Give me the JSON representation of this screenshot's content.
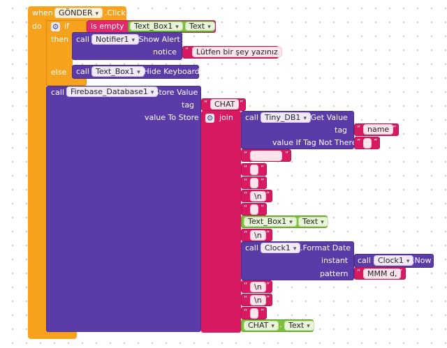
{
  "event": {
    "when": "when",
    "component": "GÖNDER",
    "event_name": ".Click",
    "do": "do"
  },
  "if_block": {
    "if": "if",
    "is_empty": "is empty",
    "then": "then",
    "else": "else"
  },
  "textbox_text": {
    "component": "Text_Box1",
    "prop": "Text",
    "dot": "."
  },
  "show_alert": {
    "call": "call",
    "component": "Notifier1",
    "method": ".Show Alert",
    "notice_label": "notice",
    "notice_value": "Lütfen bir şey yazınız"
  },
  "hide_keyboard": {
    "call": "call",
    "component": "Text_Box1",
    "method": ".Hide Keyboard"
  },
  "store_value": {
    "call": "call",
    "component": "Firebase_Database1",
    "method": ".Store Value",
    "tag_label": "tag",
    "tag_value": "CHAT",
    "value_label": "value To Store"
  },
  "join": {
    "label": "join"
  },
  "get_value": {
    "call": "call",
    "component": "Tiny_DB1",
    "method": ".Get Value",
    "tag_label": "tag",
    "tag_value": "name",
    "default_label": "value If Tag Not There"
  },
  "join_items": {
    "item_newline_1": "\\n",
    "item_textbox_component": "Text_Box1",
    "item_textbox_prop": "Text",
    "item_newline_2": "\\n",
    "item_newline_3": "\\n",
    "item_newline_4": "\\n",
    "item_chat_component": "CHAT",
    "item_chat_prop": "Text"
  },
  "format_date": {
    "call": "call",
    "component": "Clock1",
    "method": ".Format Date",
    "instant_label": "instant",
    "pattern_label": "pattern",
    "pattern_value": "MMM d,"
  },
  "clock_now": {
    "call": "call",
    "component": "Clock1",
    "method": ".Now"
  },
  "quote_open": "“",
  "quote_close": "”",
  "icons": {
    "gear": "gear-icon",
    "dropdown": "chevron-down-icon"
  }
}
